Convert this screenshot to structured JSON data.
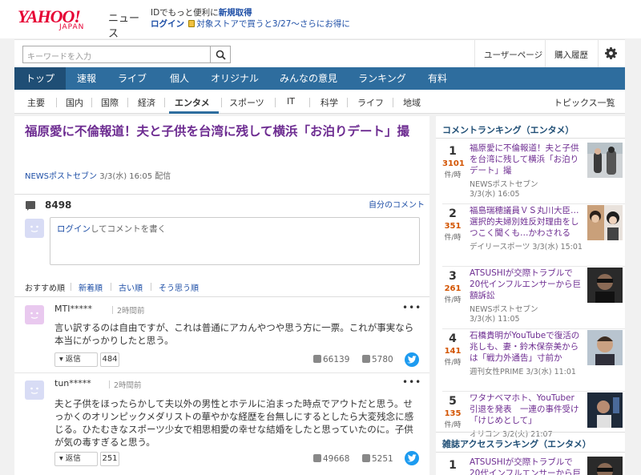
{
  "header": {
    "logo_main": "YAHOO!",
    "logo_sub": "JAPAN",
    "logo_section": "ニュース",
    "promo_line1": "IDでもっと便利に",
    "promo_line1_link": "新規取得",
    "promo_line2_login": "ログイン",
    "promo_line2_text": "対象ストアで買うと3/27〜さらにお得に"
  },
  "search": {
    "placeholder": "キーワードを入力",
    "user_page": "ユーザーページ",
    "purchase_history": "購入履歴"
  },
  "main_nav": [
    "トップ",
    "速報",
    "ライブ",
    "個人",
    "オリジナル",
    "みんなの意見",
    "ランキング",
    "有料"
  ],
  "sub_nav": [
    "主要",
    "国内",
    "国際",
    "経済",
    "エンタメ",
    "スポーツ",
    "IT",
    "科学",
    "ライフ",
    "地域"
  ],
  "sub_nav_topics": "トピックス一覧",
  "article": {
    "title": "福原愛に不倫報道！夫と子供を台湾に残して横浜「お泊りデート」撮",
    "source": "NEWSポストセブン",
    "date": "3/3(水) 16:05 配信"
  },
  "comments_section": {
    "my_comments": "自分のコメント",
    "count": "8498",
    "input_login": "ログイン",
    "input_text": "してコメントを書く",
    "sort_tabs": [
      "おすすめ順",
      "新着順",
      "古い順",
      "そう思う順"
    ]
  },
  "comments": [
    {
      "user": "MTI*****",
      "time": "2時間前",
      "text": "言い訳するのは自由ですが、これは普通にアカんやつや思う方に一票。これが事実なら本当にがっかりしたと思う。",
      "reply_label": "返信",
      "reply_count": "484",
      "likes": "66139",
      "dislikes": "5780"
    },
    {
      "user": "tun*****",
      "time": "2時間前",
      "text": "夫と子供をほったらかして夫以外の男性とホテルに泊まった時点でアウトだと思う。せっかくのオリンピックメダリストの華やかな経歴を台無しにするとしたら大変残念に感じる。ひたむきなスポーツ少女で相思相愛の幸せな結婚をしたと思っていたのに。子供が気の毒すぎると思う。",
      "reply_label": "返信",
      "reply_count": "251",
      "likes": "49668",
      "dislikes": "5251"
    }
  ],
  "sidebar": {
    "comment_ranking_title": "コメントランキング（エンタメ）",
    "unit": "件/時",
    "rankings": [
      {
        "rank": "1",
        "count": "3101",
        "title": "福原愛に不倫報道！夫と子供を台湾に残して横浜「お泊りデート」撮",
        "source": "NEWSポストセブン",
        "date": "3/3(水) 16:05"
      },
      {
        "rank": "2",
        "count": "351",
        "title": "福島瑞穂議員ＶＳ丸川大臣…選択的夫婦別姓反対理由をしつこく聞くも…かわされる",
        "source": "デイリースポーツ",
        "date": "3/3(水) 15:01"
      },
      {
        "rank": "3",
        "count": "261",
        "title": "ATSUSHIが交際トラブルで20代インフルエンサーから巨額訴訟",
        "source": "NEWSポストセブン",
        "date": "3/3(水) 11:05"
      },
      {
        "rank": "4",
        "count": "141",
        "title": "石橋貴明がYouTubeで復活の兆しも、妻・鈴木保奈美からは「戦力外通告」寸前か",
        "source": "週刊女性PRIME",
        "date": "3/3(水) 11:01"
      },
      {
        "rank": "5",
        "count": "135",
        "title": "ワタナベマホト、YouTuber引退を発表　一連の事件受け「けじめとして」",
        "source": "オリコン",
        "date": "3/2(火) 21:07"
      }
    ],
    "access_ranking_title": "雑誌アクセスランキング（エンタメ）",
    "access_rankings": [
      {
        "rank": "1",
        "title": "ATSUSHIが交際トラブルで20代インフルエンサーから巨額訴訟"
      }
    ]
  }
}
